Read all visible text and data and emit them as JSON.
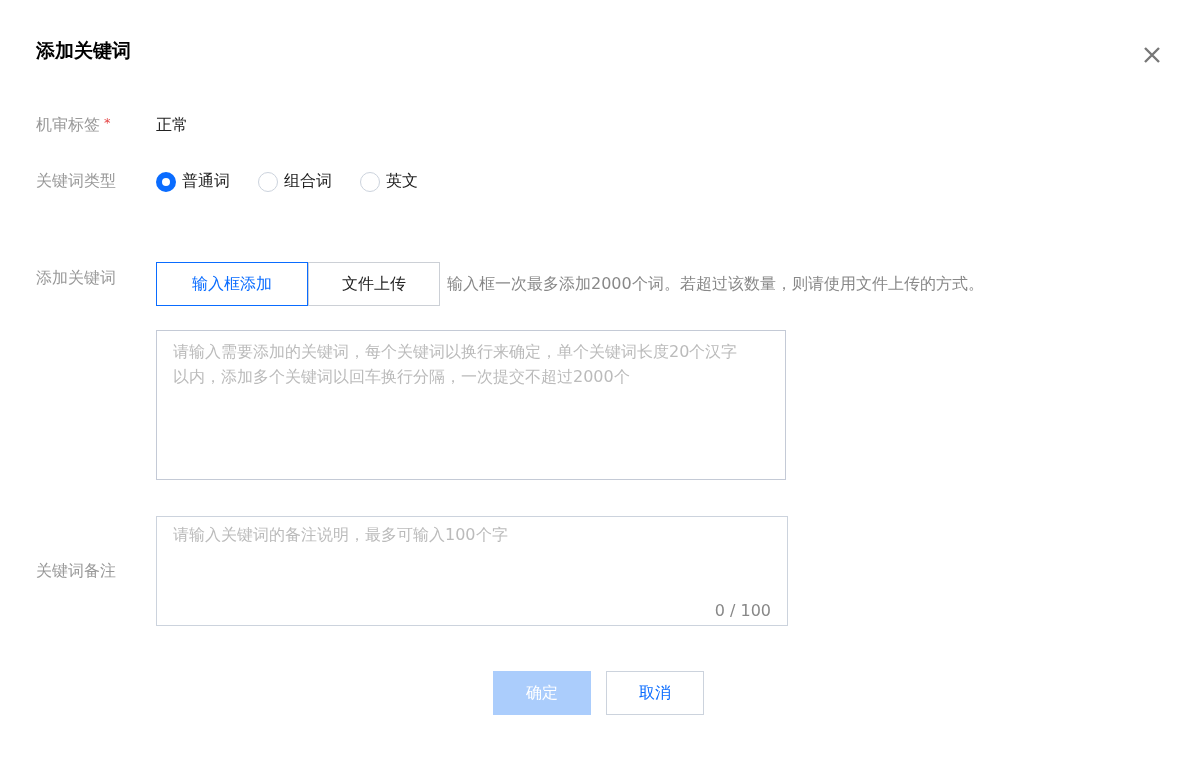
{
  "dialog": {
    "title": "添加关键词"
  },
  "review_tag": {
    "label": "机审标签",
    "required": true,
    "required_mark": "*",
    "value": "正常"
  },
  "keyword_type": {
    "label": "关键词类型",
    "options": [
      {
        "label": "普通词",
        "selected": true
      },
      {
        "label": "组合词",
        "selected": false
      },
      {
        "label": "英文",
        "selected": false
      }
    ]
  },
  "add_keywords": {
    "label": "添加关键词",
    "tabs": [
      {
        "label": "输入框添加",
        "selected": true
      },
      {
        "label": "文件上传",
        "selected": false
      }
    ],
    "hint": "输入框一次最多添加2000个词。若超过该数量，则请使用文件上传的方式。",
    "placeholder": "请输入需要添加的关键词，每个关键词以换行来确定，单个关键词长度20个汉字以内，添加多个关键词以回车换行分隔，一次提交不超过2000个"
  },
  "remark": {
    "label": "关键词备注",
    "placeholder": "请输入关键词的备注说明，最多可输入100个字",
    "counter": "0 / 100"
  },
  "buttons": [
    {
      "label": "确定",
      "kind": "primary",
      "disabled": true
    },
    {
      "label": "取消",
      "kind": "secondary",
      "disabled": false
    }
  ]
}
